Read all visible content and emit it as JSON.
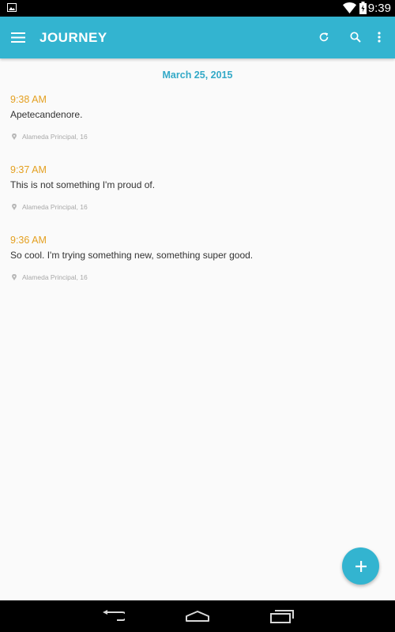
{
  "status_bar": {
    "time": "9:39",
    "icons": [
      "gallery-icon",
      "wifi-icon",
      "battery-icon"
    ]
  },
  "app_bar": {
    "title": "JOURNEY",
    "color": "#33b4d0",
    "actions": [
      "refresh-icon",
      "search-icon",
      "overflow-menu-icon"
    ]
  },
  "timeline": {
    "date": "March 25, 2015",
    "entries": [
      {
        "time": "9:38 AM",
        "text": "Apetecandenore.",
        "location": "Alameda Principal, 16"
      },
      {
        "time": "9:37 AM",
        "text": "This is not something I'm proud of.",
        "location": "Alameda Principal, 16"
      },
      {
        "time": "9:36 AM",
        "text": "So cool.  I'm trying something new, something super good.",
        "location": "Alameda Principal, 16"
      }
    ]
  },
  "fab": {
    "icon": "plus-icon"
  },
  "nav_bar": {
    "buttons": [
      "back-icon",
      "home-icon",
      "recents-icon"
    ]
  },
  "colors": {
    "accent": "#33b4d0",
    "time": "#e4a020",
    "date": "#33a9c7"
  }
}
